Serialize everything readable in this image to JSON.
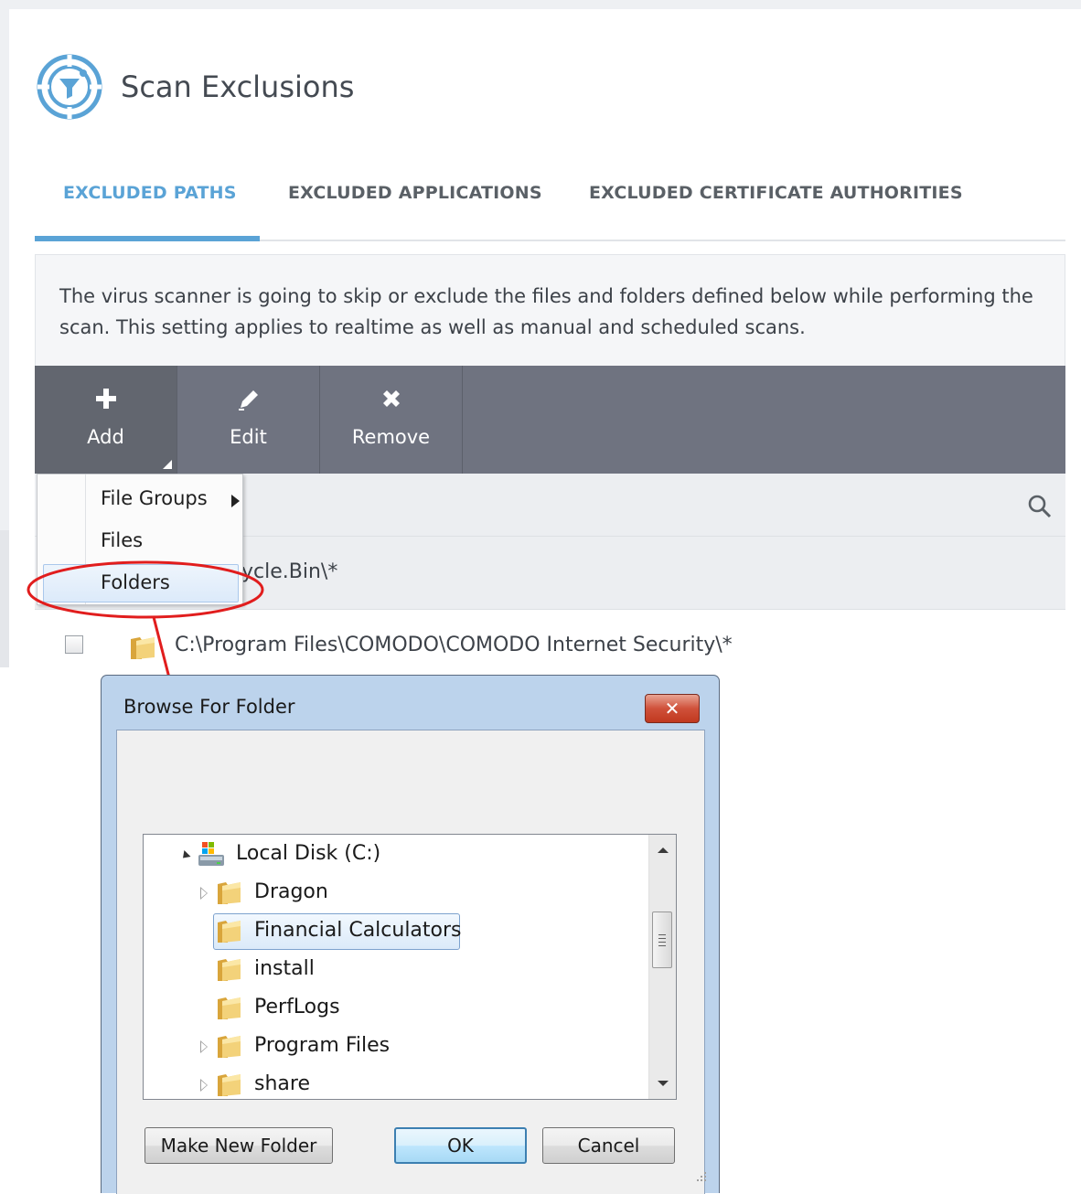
{
  "app": {
    "title": "Scan Exclusions",
    "accent_color": "#5aa3d6",
    "header_icon": "filter-shield-icon"
  },
  "tabs": [
    {
      "label": "EXCLUDED PATHS",
      "active": true
    },
    {
      "label": "EXCLUDED APPLICATIONS",
      "active": false
    },
    {
      "label": "EXCLUDED CERTIFICATE AUTHORITIES",
      "active": false
    }
  ],
  "description": "The virus scanner is going to skip or exclude the files and folders defined below while performing the scan. This setting applies to realtime as well as manual and scheduled scans.",
  "toolbar": {
    "add": {
      "label": "Add",
      "icon": "plus-icon"
    },
    "edit": {
      "label": "Edit",
      "icon": "pencil-icon"
    },
    "remove": {
      "label": "Remove",
      "icon": "x-icon"
    }
  },
  "search": {
    "icon": "search-icon"
  },
  "add_menu": {
    "items": [
      {
        "label": "File Groups",
        "has_submenu": true
      },
      {
        "label": "Files",
        "has_submenu": false
      },
      {
        "label": "Folders",
        "has_submenu": false,
        "highlighted": true
      }
    ]
  },
  "list": {
    "rows": [
      {
        "path_visible": "ycle.Bin\\*"
      },
      {
        "path": "C:\\Program Files\\COMODO\\COMODO Internet Security\\*",
        "checked": false
      }
    ]
  },
  "dialog": {
    "title": "Browse For Folder",
    "close_label": "✕",
    "tree": {
      "root": "Local Disk (C:)",
      "items": [
        {
          "label": "Dragon",
          "expandable": true,
          "selected": false
        },
        {
          "label": "Financial Calculators",
          "expandable": false,
          "selected": true
        },
        {
          "label": "install",
          "expandable": false,
          "selected": false
        },
        {
          "label": "PerfLogs",
          "expandable": false,
          "selected": false
        },
        {
          "label": "Program Files",
          "expandable": true,
          "selected": false
        },
        {
          "label": "share",
          "expandable": true,
          "selected": false
        }
      ]
    },
    "buttons": {
      "make_new_folder": "Make New Folder",
      "ok": "OK",
      "cancel": "Cancel"
    }
  }
}
